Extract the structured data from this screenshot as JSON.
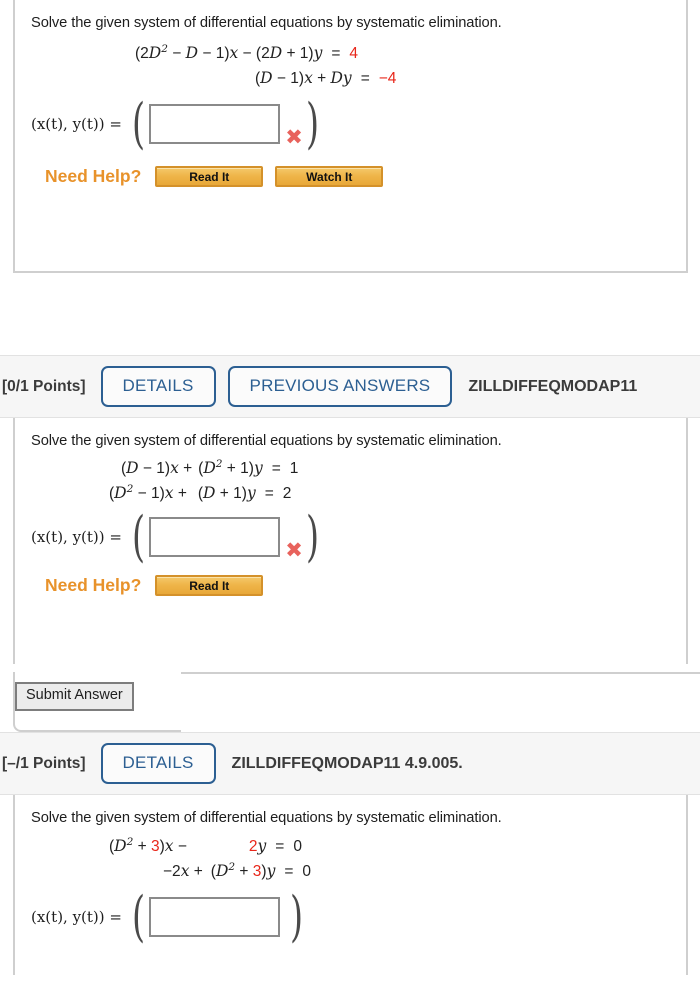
{
  "page": {
    "prompt_text": "Solve the given system of differential equations by systematic elimination.",
    "answer_label": "(x(t), y(t)) =",
    "need_help_label": "Need Help?",
    "read_it_label": "Read It",
    "watch_it_label": "Watch It",
    "submit_label": "Submit Answer",
    "x_mark": "✖",
    "paren_left": "(",
    "paren_right": ")",
    "colors": {
      "accent_blue": "#2c5f92",
      "need_help_orange": "#e8922a",
      "error_red": "#e8625c",
      "equation_red": "#e8261a",
      "button_gold": "#efb54a",
      "panel_border": "#cfcfcf"
    }
  },
  "questions": [
    {
      "id": "q1",
      "prompt": "Solve the given system of differential equations by systematic elimination.",
      "equations": [
        {
          "line": 1,
          "lhs_parts": [
            {
              "text": "(2D",
              "style": "italic-mixed"
            },
            {
              "text": "2",
              "style": "superscript"
            },
            {
              "text": " − D − 1)x − (2D + 1)y",
              "style": "italic-mixed"
            }
          ],
          "plain": "(2D² − D − 1)x − (2D + 1)y",
          "eq": "=",
          "rhs": "4",
          "rhs_color": "red"
        },
        {
          "line": 2,
          "plain": "(D − 1)x + Dy",
          "eq": "=",
          "rhs": "−4",
          "rhs_color": "red"
        }
      ],
      "answer_value": "",
      "answer_marked_wrong": true,
      "help_buttons": [
        "Read It",
        "Watch It"
      ]
    },
    {
      "id": "q2",
      "header": {
        "points": "[0/1 Points]",
        "details_label": "DETAILS",
        "previous_answers_label": "PREVIOUS ANSWERS",
        "code": "ZILLDIFFEQMODAP11"
      },
      "prompt": "Solve the given system of differential equations by systematic elimination.",
      "equations": [
        {
          "line": 1,
          "plain": "(D − 1)x + (D² + 1)y",
          "eq": "=",
          "rhs": "1",
          "rhs_color": "black"
        },
        {
          "line": 2,
          "plain": "(D² − 1)x + (D + 1)y",
          "eq": "=",
          "rhs": "2",
          "rhs_color": "black"
        }
      ],
      "answer_value": "",
      "answer_marked_wrong": true,
      "help_buttons": [
        "Read It"
      ],
      "submit_label": "Submit Answer"
    },
    {
      "id": "q3",
      "header": {
        "points": "[–/1 Points]",
        "details_label": "DETAILS",
        "code": "ZILLDIFFEQMODAP11 4.9.005."
      },
      "prompt": "Solve the given system of differential equations by systematic elimination.",
      "equations": [
        {
          "line": 1,
          "plain": "(D² + 3)x − 2y",
          "eq": "=",
          "rhs": "0",
          "rhs_color": "black",
          "red_tokens": [
            "3",
            "2"
          ]
        },
        {
          "line": 2,
          "plain": "−2x + (D² + 3)y",
          "eq": "=",
          "rhs": "0",
          "rhs_color": "black",
          "red_tokens": [
            "3"
          ]
        }
      ],
      "answer_value": "",
      "answer_marked_wrong": false
    }
  ]
}
